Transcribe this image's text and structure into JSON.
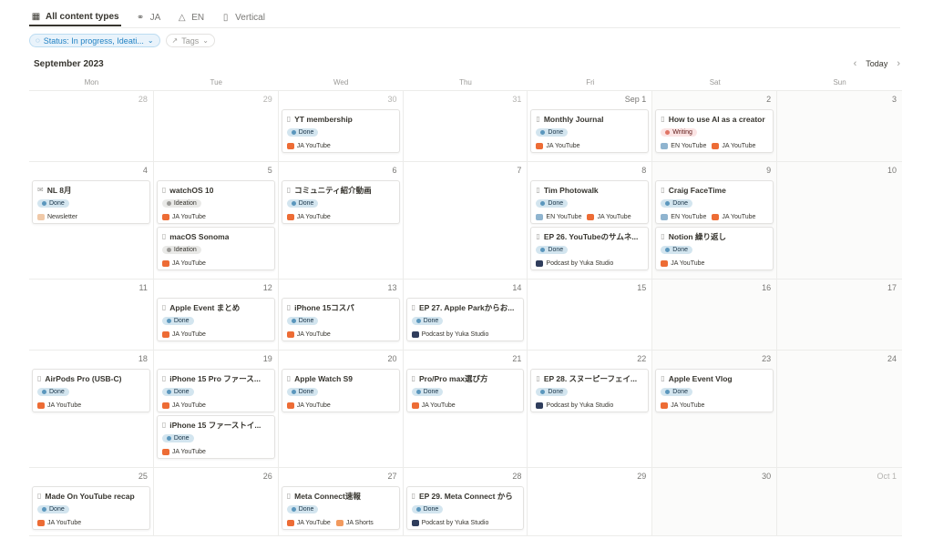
{
  "tabs": [
    {
      "label": "All content types",
      "icon": "table-icon",
      "active": true
    },
    {
      "label": "JA",
      "icon": "globe-icon",
      "active": false
    },
    {
      "label": "EN",
      "icon": "megaphone-icon",
      "active": false
    },
    {
      "label": "Vertical",
      "icon": "phone-icon",
      "active": false
    }
  ],
  "filters": {
    "status_label": "Status: In progress, Ideati...",
    "tags_label": "Tags"
  },
  "calendar": {
    "month_label": "September 2023",
    "today_label": "Today",
    "weekdays": [
      "Mon",
      "Tue",
      "Wed",
      "Thu",
      "Fri",
      "Sat",
      "Sun"
    ],
    "weeks": [
      [
        {
          "day": "28",
          "other": true,
          "cards": []
        },
        {
          "day": "29",
          "other": true,
          "cards": []
        },
        {
          "day": "30",
          "other": true,
          "cards": [
            {
              "title": "YT membership",
              "status": "Done",
              "kind": "done",
              "channels": [
                {
                  "label": "JA YouTube",
                  "type": "yt"
                }
              ]
            }
          ]
        },
        {
          "day": "31",
          "other": true,
          "cards": []
        },
        {
          "day": "Sep 1",
          "cards": [
            {
              "title": "Monthly Journal",
              "status": "Done",
              "kind": "done",
              "channels": [
                {
                  "label": "JA YouTube",
                  "type": "yt"
                }
              ]
            }
          ]
        },
        {
          "day": "2",
          "weekend": true,
          "cards": [
            {
              "title": "How to use AI as a creator",
              "status": "Writing",
              "kind": "writing",
              "channels": [
                {
                  "label": "EN YouTube",
                  "type": "en"
                },
                {
                  "label": "JA YouTube",
                  "type": "yt"
                }
              ]
            }
          ]
        },
        {
          "day": "3",
          "weekend": true,
          "cards": []
        }
      ],
      [
        {
          "day": "4",
          "cards": [
            {
              "title": "NL 8月",
              "status": "Done",
              "kind": "done",
              "icon": "mail",
              "channels": [
                {
                  "label": "Newsletter",
                  "type": "nl"
                }
              ]
            }
          ]
        },
        {
          "day": "5",
          "cards": [
            {
              "title": "watchOS 10",
              "status": "Ideation",
              "kind": "ideation",
              "channels": [
                {
                  "label": "JA YouTube",
                  "type": "yt"
                }
              ]
            },
            {
              "title": "macOS Sonoma",
              "status": "Ideation",
              "kind": "ideation",
              "channels": [
                {
                  "label": "JA YouTube",
                  "type": "yt"
                }
              ]
            }
          ]
        },
        {
          "day": "6",
          "cards": [
            {
              "title": "コミュニティ紹介動画",
              "status": "Done",
              "kind": "done",
              "channels": [
                {
                  "label": "JA YouTube",
                  "type": "yt"
                }
              ]
            }
          ]
        },
        {
          "day": "7",
          "cards": []
        },
        {
          "day": "8",
          "cards": [
            {
              "title": "Tim Photowalk",
              "status": "Done",
              "kind": "done",
              "channels": [
                {
                  "label": "EN YouTube",
                  "type": "en"
                },
                {
                  "label": "JA YouTube",
                  "type": "yt"
                }
              ]
            },
            {
              "title": "EP 26. YouTubeのサムネ...",
              "status": "Done",
              "kind": "done",
              "channels": [
                {
                  "label": "Podcast by Yuka Studio",
                  "type": "pod"
                }
              ]
            }
          ]
        },
        {
          "day": "9",
          "weekend": true,
          "cards": [
            {
              "title": "Craig FaceTime",
              "status": "Done",
              "kind": "done",
              "channels": [
                {
                  "label": "EN YouTube",
                  "type": "en"
                },
                {
                  "label": "JA YouTube",
                  "type": "yt"
                }
              ]
            },
            {
              "title": "Notion 繰り返し",
              "status": "Done",
              "kind": "done",
              "channels": [
                {
                  "label": "JA YouTube",
                  "type": "yt"
                }
              ]
            }
          ]
        },
        {
          "day": "10",
          "weekend": true,
          "cards": []
        }
      ],
      [
        {
          "day": "11",
          "cards": []
        },
        {
          "day": "12",
          "cards": [
            {
              "title": "Apple Event まとめ",
              "status": "Done",
              "kind": "done",
              "channels": [
                {
                  "label": "JA YouTube",
                  "type": "yt"
                }
              ]
            }
          ]
        },
        {
          "day": "13",
          "cards": [
            {
              "title": "iPhone 15コスパ",
              "status": "Done",
              "kind": "done",
              "channels": [
                {
                  "label": "JA YouTube",
                  "type": "yt"
                }
              ]
            }
          ]
        },
        {
          "day": "14",
          "cards": [
            {
              "title": "EP 27. Apple Parkからお...",
              "status": "Done",
              "kind": "done",
              "channels": [
                {
                  "label": "Podcast by Yuka Studio",
                  "type": "pod"
                }
              ]
            }
          ]
        },
        {
          "day": "15",
          "cards": []
        },
        {
          "day": "16",
          "weekend": true,
          "cards": []
        },
        {
          "day": "17",
          "weekend": true,
          "cards": []
        }
      ],
      [
        {
          "day": "18",
          "cards": [
            {
              "title": "AirPods Pro (USB-C)",
              "status": "Done",
              "kind": "done",
              "channels": [
                {
                  "label": "JA YouTube",
                  "type": "yt"
                }
              ]
            }
          ]
        },
        {
          "day": "19",
          "cards": [
            {
              "title": "iPhone 15 Pro ファース...",
              "status": "Done",
              "kind": "done",
              "channels": [
                {
                  "label": "JA YouTube",
                  "type": "yt"
                }
              ]
            },
            {
              "title": "iPhone 15 ファーストイ...",
              "status": "Done",
              "kind": "done",
              "channels": [
                {
                  "label": "JA YouTube",
                  "type": "yt"
                }
              ]
            }
          ]
        },
        {
          "day": "20",
          "cards": [
            {
              "title": "Apple Watch S9",
              "status": "Done",
              "kind": "done",
              "channels": [
                {
                  "label": "JA YouTube",
                  "type": "yt"
                }
              ]
            }
          ]
        },
        {
          "day": "21",
          "cards": [
            {
              "title": "Pro/Pro max選び方",
              "status": "Done",
              "kind": "done",
              "channels": [
                {
                  "label": "JA YouTube",
                  "type": "yt"
                }
              ]
            }
          ]
        },
        {
          "day": "22",
          "cards": [
            {
              "title": "EP 28. スヌーピーフェイ...",
              "status": "Done",
              "kind": "done",
              "channels": [
                {
                  "label": "Podcast by Yuka Studio",
                  "type": "pod"
                }
              ]
            }
          ]
        },
        {
          "day": "23",
          "weekend": true,
          "cards": [
            {
              "title": "Apple Event Vlog",
              "status": "Done",
              "kind": "done",
              "channels": [
                {
                  "label": "JA YouTube",
                  "type": "yt"
                }
              ]
            }
          ]
        },
        {
          "day": "24",
          "weekend": true,
          "cards": []
        }
      ],
      [
        {
          "day": "25",
          "cards": [
            {
              "title": "Made On YouTube recap",
              "status": "Done",
              "kind": "done",
              "channels": [
                {
                  "label": "JA YouTube",
                  "type": "yt"
                }
              ]
            }
          ]
        },
        {
          "day": "26",
          "cards": []
        },
        {
          "day": "27",
          "cards": [
            {
              "title": "Meta Connect速報",
              "status": "Done",
              "kind": "done",
              "channels": [
                {
                  "label": "JA YouTube",
                  "type": "yt"
                },
                {
                  "label": "JA Shorts",
                  "type": "shorts"
                }
              ]
            }
          ]
        },
        {
          "day": "28",
          "cards": [
            {
              "title": "EP 29. Meta Connect から",
              "status": "Done",
              "kind": "done",
              "channels": [
                {
                  "label": "Podcast by Yuka Studio",
                  "type": "pod"
                }
              ]
            }
          ]
        },
        {
          "day": "29",
          "cards": []
        },
        {
          "day": "30",
          "weekend": true,
          "cards": []
        },
        {
          "day": "Oct 1",
          "other": true,
          "weekend": true,
          "cards": []
        }
      ]
    ]
  }
}
